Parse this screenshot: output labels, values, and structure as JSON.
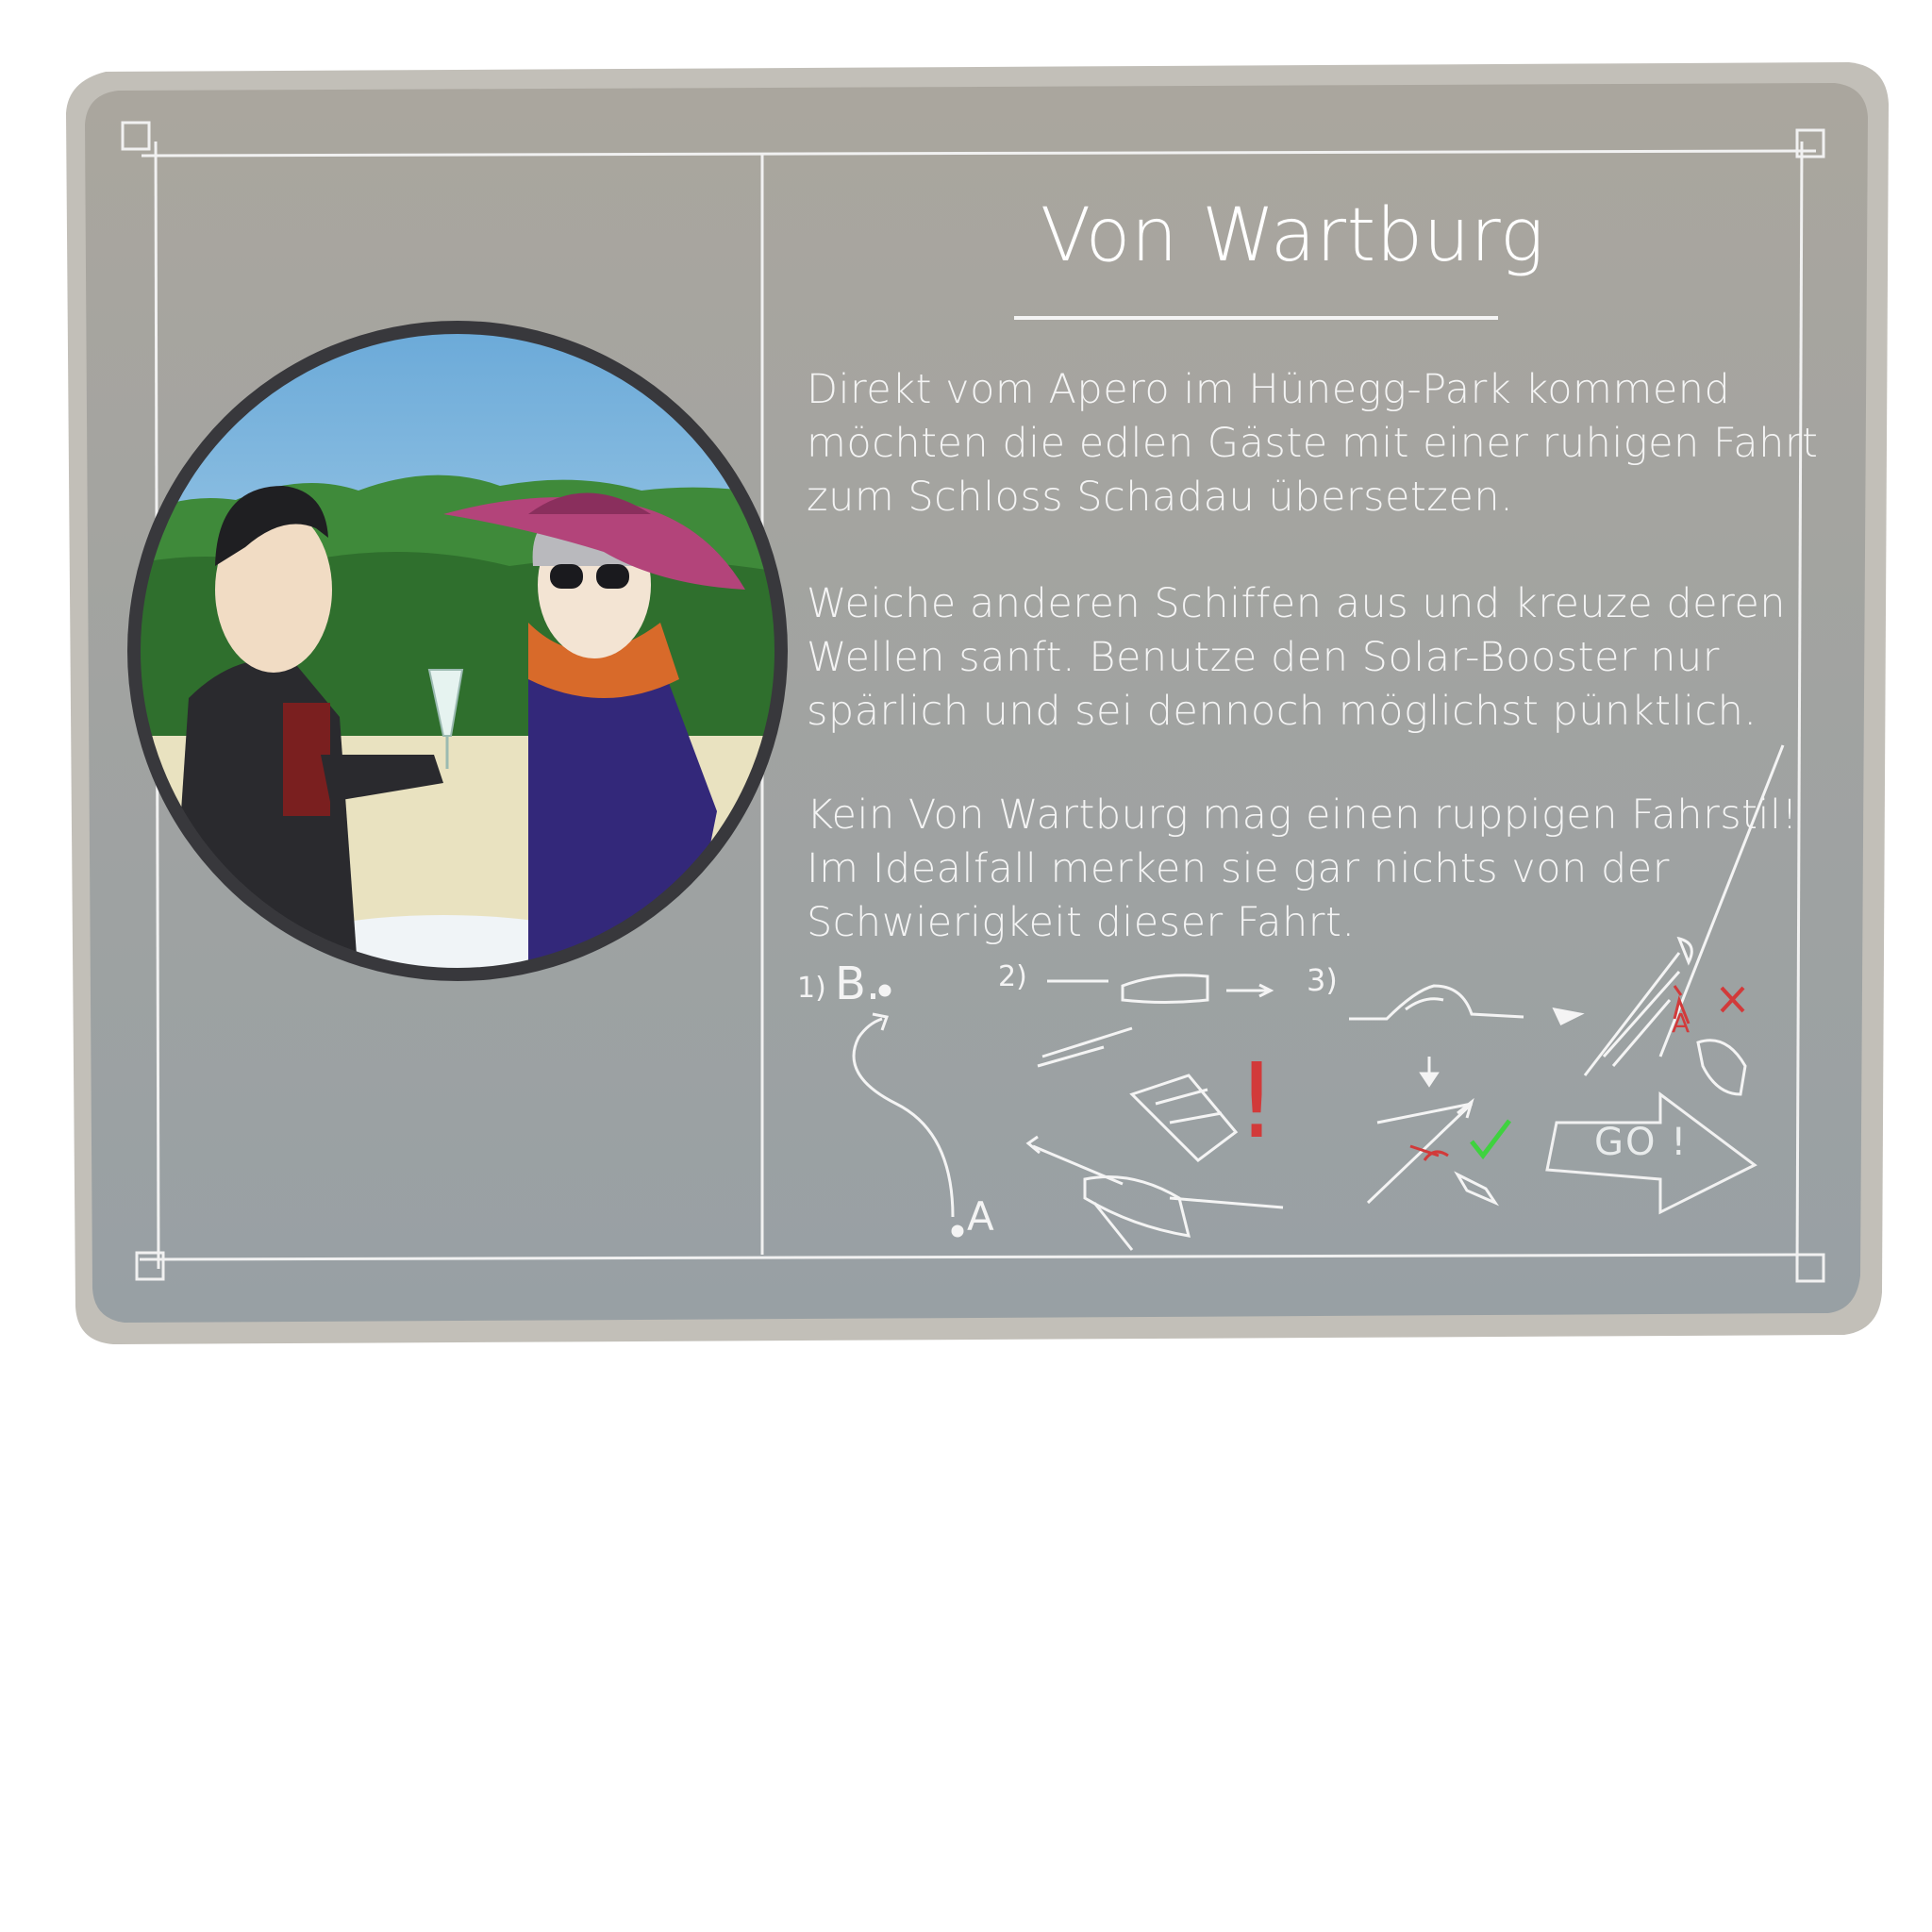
{
  "card": {
    "title": "Von Wartburg",
    "paragraphs": [
      "Direkt vom Apero im Hünegg-Park kommend\nmöchten die edlen Gäste mit einer ruhigen Fahrt\nzum Schloss Schadau übersetzen.",
      "Weiche anderen Schiffen aus und kreuze deren\nWellen sanft. Benutze den Solar-Booster nur\nspärlich und sei dennoch möglichst pünktlich.",
      "Kein Von Wartburg mag einen ruppigen Fahrstil!\nIm Idealfall merken sie gar nichts von der\nSchwierigkeit dieser Fahrt."
    ]
  },
  "instructions": {
    "step1": {
      "number": "1)",
      "start": "A",
      "target": "B."
    },
    "step2": {
      "number": "2)",
      "warning": "!"
    },
    "step3": {
      "number": "3)",
      "point": "A"
    }
  },
  "go_button": {
    "label": "GO !"
  },
  "colors": {
    "panel": "#a6a49f",
    "panel_border": "#c2bfb8",
    "ink": "#f4f4f4",
    "warning_red": "#d23a3a",
    "check_green": "#3fd23f",
    "sky": "#9cc8e6",
    "hat": "#b3447a",
    "coat": "#33287a",
    "scarf": "#d86a2a"
  }
}
